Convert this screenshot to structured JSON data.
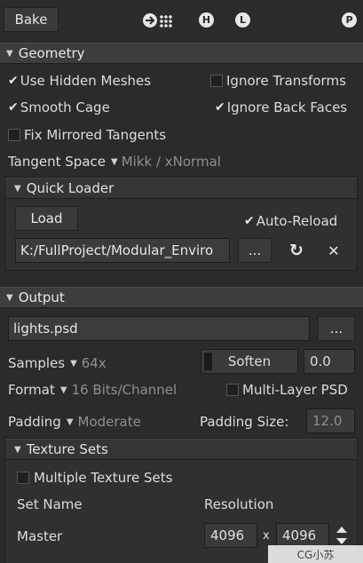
{
  "toolbar": {
    "bake_label": "Bake",
    "icons": [
      "arrow-dots-icon",
      "h-circle-icon",
      "l-circle-icon",
      "p-circle-icon"
    ],
    "h_letter": "H",
    "l_letter": "L",
    "p_letter": "P"
  },
  "geometry": {
    "header": "Geometry",
    "use_hidden_meshes": "Use Hidden Meshes",
    "ignore_transforms": "Ignore Transforms",
    "smooth_cage": "Smooth Cage",
    "ignore_back_faces": "Ignore Back Faces",
    "fix_mirrored_tangents": "Fix Mirrored Tangents",
    "tangent_space_label": "Tangent Space",
    "tangent_space_value": "Mikk / xNormal",
    "checked": {
      "use_hidden_meshes": true,
      "ignore_transforms": false,
      "smooth_cage": true,
      "ignore_back_faces": true,
      "fix_mirrored_tangents": false
    }
  },
  "quick_loader": {
    "header": "Quick Loader",
    "load_label": "Load",
    "auto_reload_label": "Auto-Reload",
    "auto_reload_checked": true,
    "path_value": "K:/FullProject/Modular_Enviro",
    "browse_label": "...",
    "reload_glyph": "↻",
    "clear_glyph": "✕"
  },
  "output": {
    "header": "Output",
    "file_value": "lights.psd",
    "browse_label": "...",
    "samples_label": "Samples",
    "samples_value": "64x",
    "soften_label": "Soften",
    "soften_value": "0.0",
    "format_label": "Format",
    "format_value": "16 Bits/Channel",
    "multi_layer_label": "Multi-Layer PSD",
    "multi_layer_checked": false,
    "padding_label": "Padding",
    "padding_value": "Moderate",
    "padding_size_label": "Padding Size:",
    "padding_size_value": "12.0"
  },
  "texture_sets": {
    "header": "Texture Sets",
    "multiple_label": "Multiple Texture Sets",
    "multiple_checked": false,
    "col_set_name": "Set Name",
    "col_resolution": "Resolution",
    "rows": [
      {
        "name": "Master",
        "width": "4096",
        "height": "4096"
      }
    ],
    "times_glyph": "x"
  },
  "watermark": {
    "text": "CG小苏"
  }
}
